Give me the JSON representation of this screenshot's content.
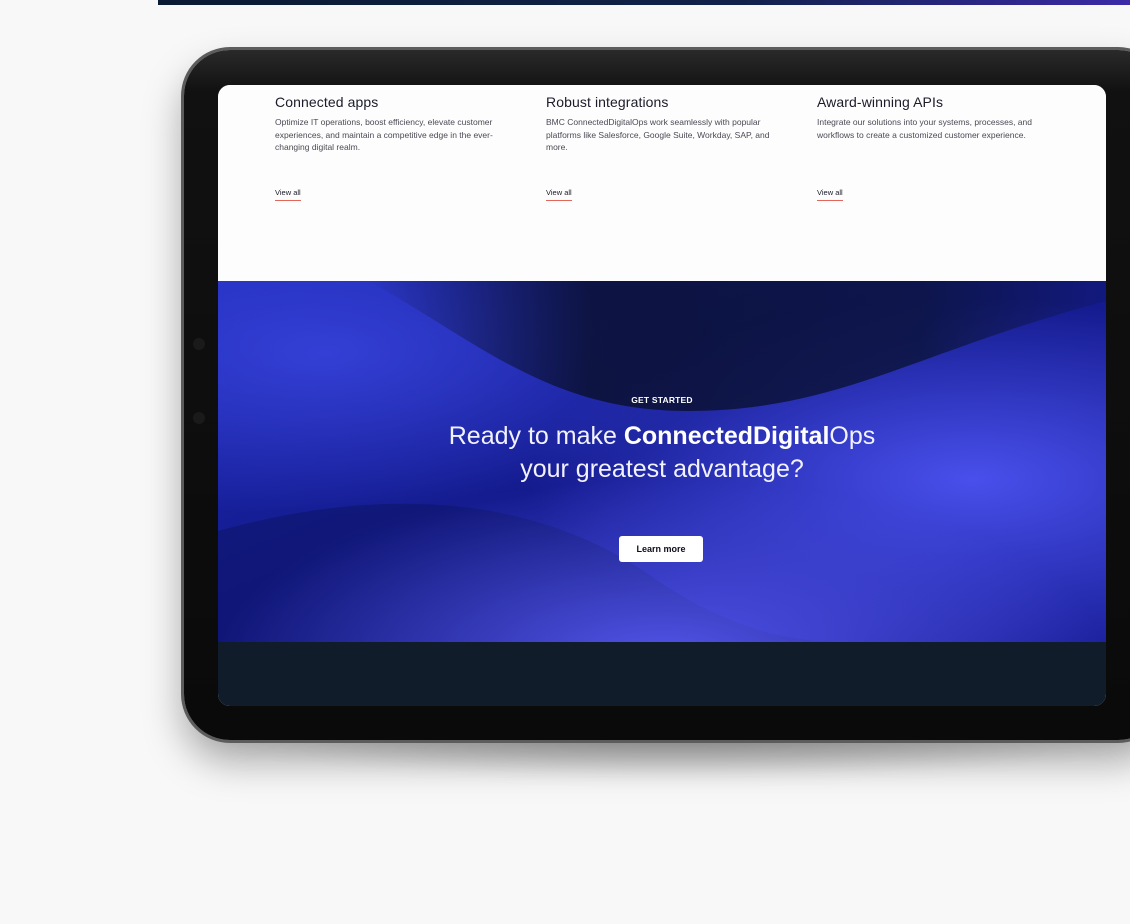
{
  "features": [
    {
      "title": "Connected apps",
      "description": "Optimize IT operations, boost efficiency, elevate customer experiences, and maintain a competitive edge in the ever-changing digital realm.",
      "link": "View all"
    },
    {
      "title": "Robust integrations",
      "description": "BMC ConnectedDigitalOps work seamlessly with popular platforms like Salesforce, Google Suite, Workday, SAP, and more.",
      "link": "View all"
    },
    {
      "title": "Award-winning APIs",
      "description": "Integrate our solutions into your systems, processes, and workflows to create a customized customer experience.",
      "link": "View all"
    }
  ],
  "hero": {
    "eyebrow": "GET STARTED",
    "headline_prefix": "Ready to make ",
    "headline_bold": "ConnectedDigital",
    "headline_suffix": "Ops",
    "headline_line2": "your greatest advantage?",
    "cta_label": "Learn more"
  },
  "colors": {
    "hero_blue": "#15198a",
    "footer": "#101c29",
    "link_underline": "#e0675a",
    "page_background": "#f8f8f8"
  }
}
